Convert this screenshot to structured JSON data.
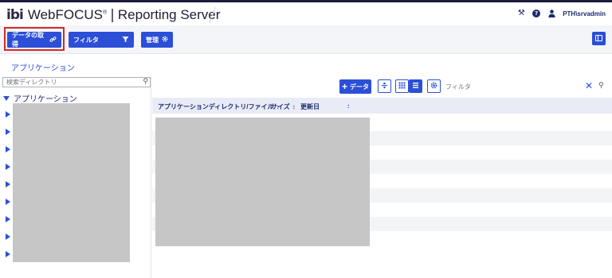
{
  "header": {
    "logo_ibi": "ibi",
    "brand": "WebFOCUS",
    "brand_mark": "®",
    "separator": "|",
    "title": "Reporting Server",
    "tools_icon": "tools-icon",
    "help_icon": "help-icon",
    "user_icon": "user-icon",
    "user": "PTH\\srvadmin"
  },
  "toolbar": {
    "get_data_label": "データの取得",
    "filter_label": "フィルタ",
    "manage_label": "管理",
    "accent": "#2b4fd7",
    "highlight": "#d62828"
  },
  "breadcrumb": "アプリケーション",
  "left_panel": {
    "search_placeholder": "検索ディレクトリ",
    "root_label": "アプリケーション",
    "items": [
      "",
      "",
      "",
      "",
      "",
      "",
      "",
      "",
      ""
    ]
  },
  "right_panel": {
    "add_data_label": "データ",
    "filter_placeholder": "フィルタ",
    "columns": [
      "アプリケーションディレクトリ/ファイル",
      "サイズ",
      "更新日"
    ]
  }
}
